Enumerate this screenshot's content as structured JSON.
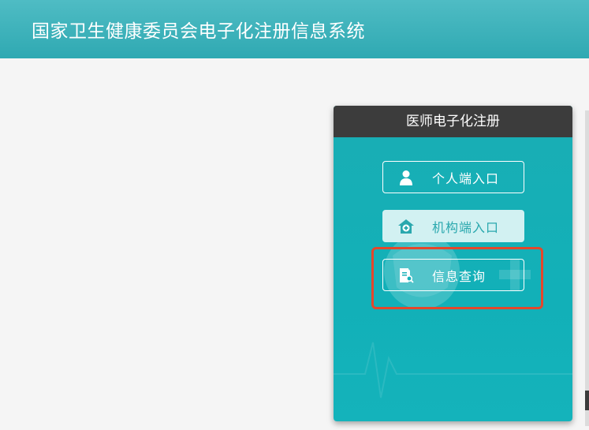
{
  "header": {
    "title": "国家卫生健康委员会电子化注册信息系统"
  },
  "card": {
    "title": "医师电子化注册",
    "buttons": [
      {
        "label": "个人端入口",
        "icon": "person-icon"
      },
      {
        "label": "机构端入口",
        "icon": "medical-house-icon"
      },
      {
        "label": "信息查询",
        "icon": "document-search-icon"
      }
    ]
  },
  "colors": {
    "header": "#3aafb8",
    "card_head": "#3c3c3c",
    "card_body": "#14b0b8",
    "highlight": "#e4472b"
  }
}
